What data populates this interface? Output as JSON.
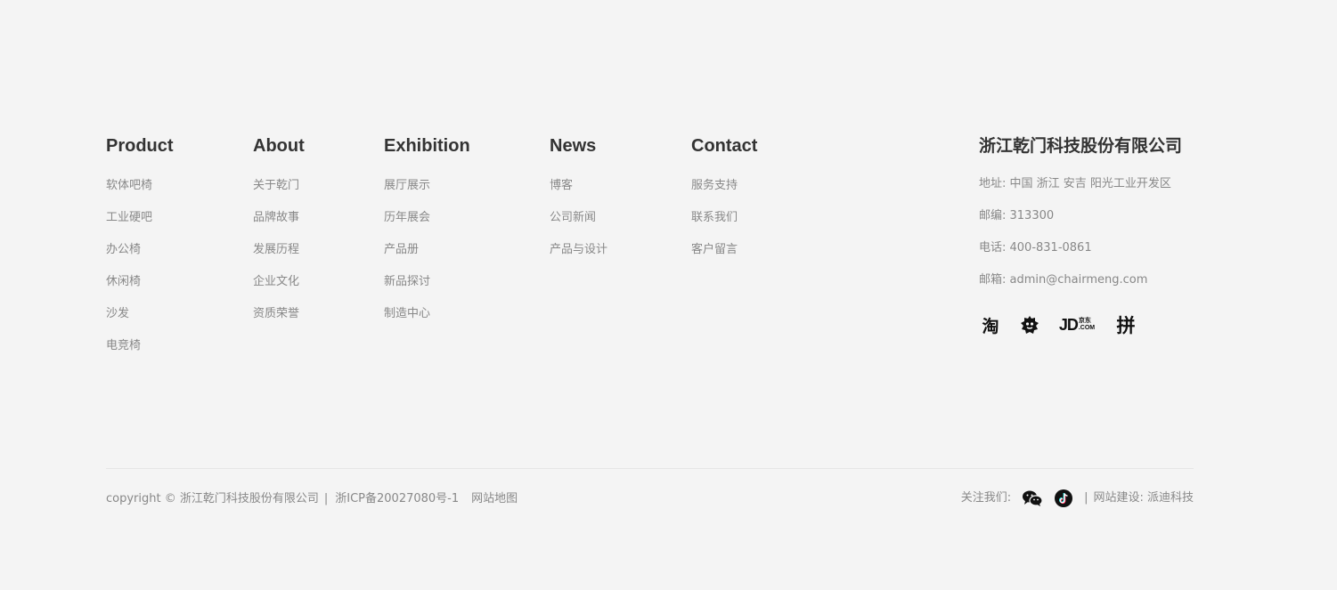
{
  "columns": [
    {
      "title": "Product",
      "items": [
        "软体吧椅",
        "工业硬吧",
        "办公椅",
        "休闲椅",
        "沙发",
        "电竞椅"
      ]
    },
    {
      "title": "About",
      "items": [
        "关于乾门",
        "品牌故事",
        "发展历程",
        "企业文化",
        "资质荣誉"
      ]
    },
    {
      "title": "Exhibition",
      "items": [
        "展厅展示",
        "历年展会",
        "产品册",
        "新品探讨",
        "制造中心"
      ]
    },
    {
      "title": "News",
      "items": [
        "博客",
        "公司新闻",
        "产品与设计"
      ]
    },
    {
      "title": "Contact",
      "items": [
        "服务支持",
        "联系我们",
        "客户留言"
      ]
    }
  ],
  "company": {
    "name": "浙江乾门科技股份有限公司",
    "address": "地址: 中国 浙江 安吉 阳光工业开发区",
    "postcode": "邮编:  313300",
    "phone": "电话: 400-831-0861",
    "email": "邮箱: admin@chairmeng.com"
  },
  "shops": {
    "taobao": "淘",
    "tmall_icon": "tmall-cat-icon",
    "jd": "JD",
    "jd_small_top": "京东",
    "jd_small_bottom": ".COM",
    "pdd": "拼"
  },
  "bottom": {
    "copyright": "copyright © 浙江乾门科技股份有限公司",
    "separator": "|",
    "icp": "浙ICP备20027080号-1",
    "sitemap": "网站地图",
    "follow": "关注我们:",
    "pipe": "|",
    "builder": "网站建设: 派迪科技",
    "wechat_icon": "wechat-icon",
    "douyin_icon": "douyin-icon"
  }
}
